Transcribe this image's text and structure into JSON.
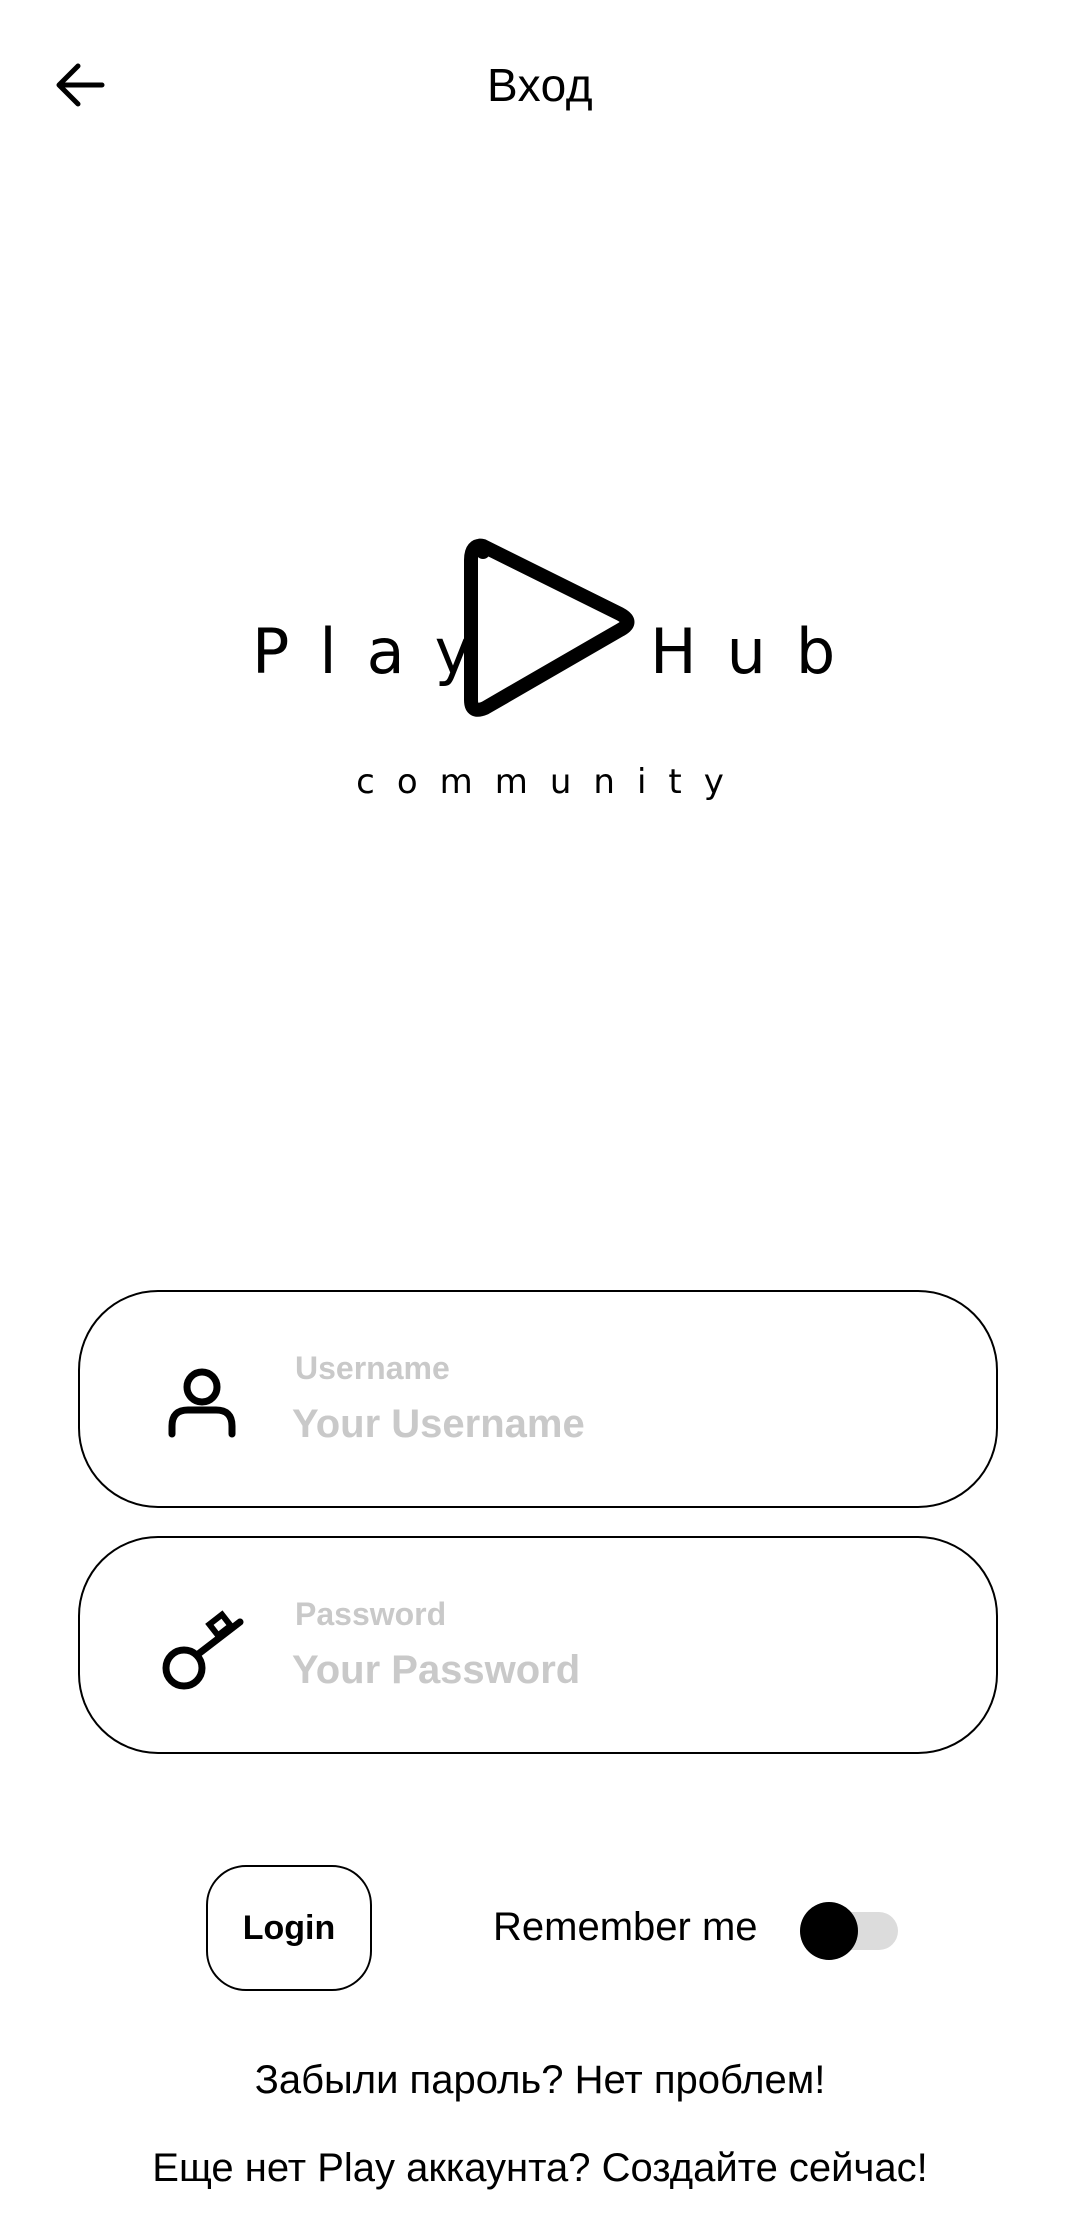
{
  "header": {
    "title": "Вход",
    "back_icon": "arrow-left-icon"
  },
  "logo": {
    "word_left": "Play",
    "word_right": "Hub",
    "tagline": "community",
    "icon": "play-triangle-icon"
  },
  "form": {
    "username": {
      "label": "Username",
      "placeholder": "Your Username",
      "value": "",
      "icon": "user-icon"
    },
    "password": {
      "label": "Password",
      "placeholder": "Your Password",
      "value": "",
      "icon": "key-icon"
    }
  },
  "actions": {
    "login_label": "Login",
    "remember_label": "Remember me",
    "remember_checked": false
  },
  "links": {
    "forgot": "Забыли пароль? Нет проблем!",
    "signup": "Еще нет Play аккаунта? Создайте сейчас!"
  },
  "colors": {
    "foreground": "#000000",
    "background": "#ffffff",
    "muted": "#c9c9c9",
    "toggle_track": "#dcdcdc"
  }
}
